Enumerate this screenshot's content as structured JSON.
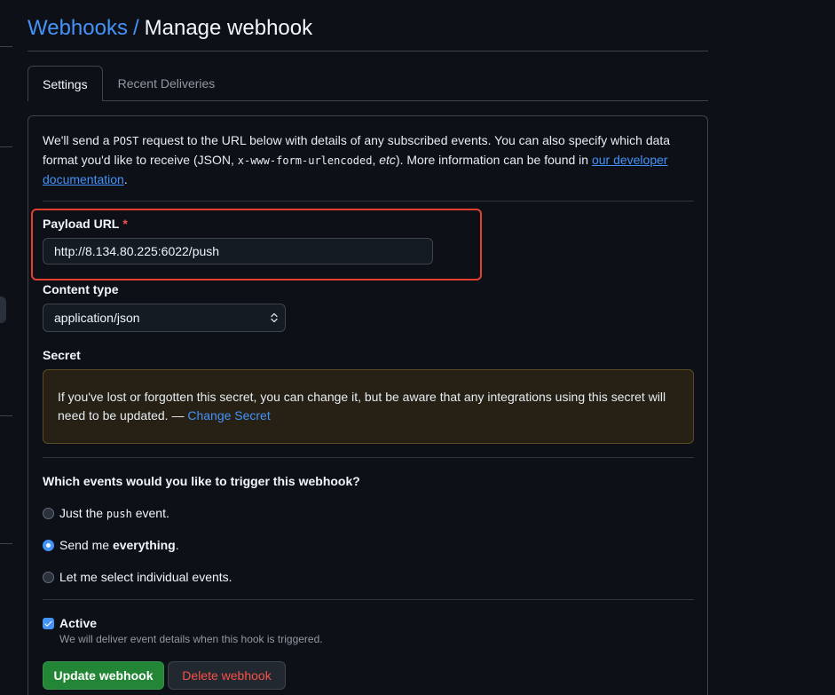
{
  "colors": {
    "background": "#0d1117",
    "text": "#e6edf3",
    "heading": "#f0f6fc",
    "muted": "#9198a1",
    "border": "#3d444d",
    "accent": "#4493f8",
    "danger": "#f85149",
    "success": "#238636",
    "attention_bg": "#272115",
    "attention_border": "#5c4a22",
    "annotation": "#e5402f"
  },
  "header": {
    "breadcrumb": "Webhooks",
    "separator": "/",
    "title": "Manage webhook"
  },
  "tabs": [
    {
      "label": "Settings",
      "selected": true
    },
    {
      "label": "Recent Deliveries",
      "selected": false
    }
  ],
  "intro": {
    "text_1": "We'll send a ",
    "code_1": "POST",
    "text_2": " request to the URL below with details of any subscribed events. You can also specify which data format you'd like to receive (JSON, ",
    "code_2": "x-www-form-urlencoded",
    "text_3": ", ",
    "emphasis": "etc",
    "text_4": "). More information can be found in ",
    "link": "our developer documentation",
    "text_5": "."
  },
  "payload_url": {
    "label": "Payload URL",
    "required_marker": "*",
    "value": "http://8.134.80.225:6022/push"
  },
  "content_type": {
    "label": "Content type",
    "selected": "application/json"
  },
  "secret": {
    "label": "Secret",
    "notice_text": "If you've lost or forgotten this secret, you can change it, but be aware that any integrations using this secret will need to be updated. — ",
    "notice_link": "Change Secret"
  },
  "events": {
    "heading": "Which events would you like to trigger this webhook?",
    "options": [
      {
        "text_before": "Just the ",
        "code": "push",
        "text_after": " event.",
        "checked": false
      },
      {
        "text_before": "Send me ",
        "strong": "everything",
        "text_after": ".",
        "checked": true
      },
      {
        "text_before": "Let me select individual events.",
        "checked": false
      }
    ]
  },
  "active": {
    "label": "Active",
    "checked": true,
    "note": "We will deliver event details when this hook is triggered."
  },
  "actions": {
    "update_label": "Update webhook",
    "delete_label": "Delete webhook"
  },
  "icons": {
    "select": "select-arrows-icon",
    "checkbox_check": "check-icon"
  }
}
